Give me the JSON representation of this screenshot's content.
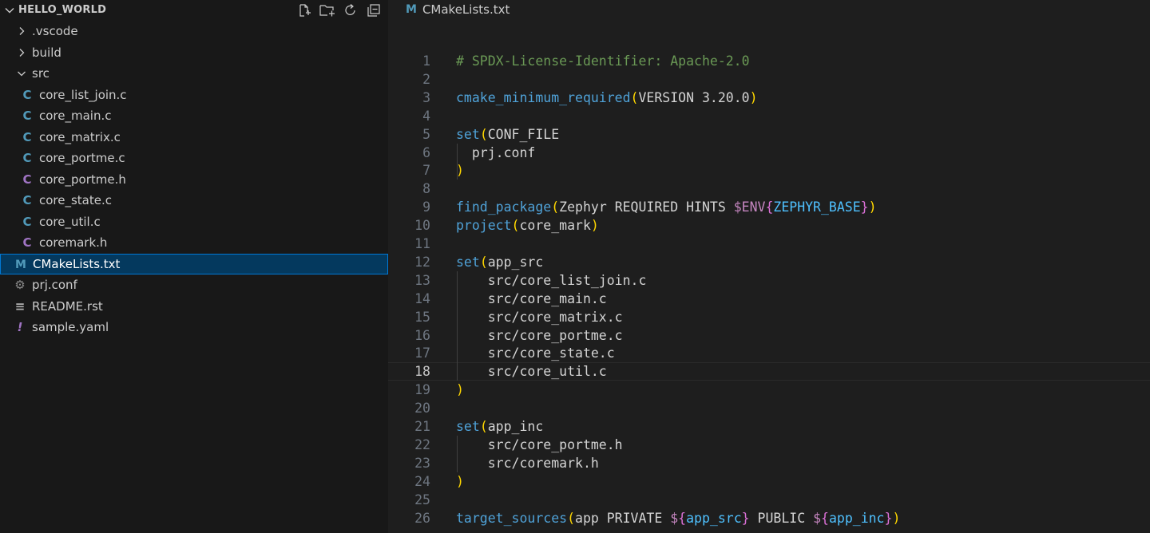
{
  "explorer": {
    "title": "HELLO_WORLD",
    "actions": [
      {
        "icon": "new-file-icon"
      },
      {
        "icon": "new-folder-icon"
      },
      {
        "icon": "refresh-icon"
      },
      {
        "icon": "collapse-all-icon"
      }
    ],
    "items": [
      {
        "label": ".vscode",
        "kind": "folder",
        "expanded": false,
        "depth": 1
      },
      {
        "label": "build",
        "kind": "folder",
        "expanded": false,
        "depth": 1
      },
      {
        "label": "src",
        "kind": "folder",
        "expanded": true,
        "depth": 1
      },
      {
        "label": "core_list_join.c",
        "kind": "c",
        "icon_glyph": "C",
        "depth": 2
      },
      {
        "label": "core_main.c",
        "kind": "c",
        "icon_glyph": "C",
        "depth": 2
      },
      {
        "label": "core_matrix.c",
        "kind": "c",
        "icon_glyph": "C",
        "depth": 2
      },
      {
        "label": "core_portme.c",
        "kind": "c",
        "icon_glyph": "C",
        "depth": 2
      },
      {
        "label": "core_portme.h",
        "kind": "h",
        "icon_glyph": "C",
        "depth": 2
      },
      {
        "label": "core_state.c",
        "kind": "c",
        "icon_glyph": "C",
        "depth": 2
      },
      {
        "label": "core_util.c",
        "kind": "c",
        "icon_glyph": "C",
        "depth": 2
      },
      {
        "label": "coremark.h",
        "kind": "h",
        "icon_glyph": "C",
        "depth": 2
      },
      {
        "label": "CMakeLists.txt",
        "kind": "cmake",
        "icon_glyph": "M",
        "depth": 1,
        "selected": true
      },
      {
        "label": "prj.conf",
        "kind": "gear",
        "icon_glyph": "⚙",
        "depth": 1
      },
      {
        "label": "README.rst",
        "kind": "lines",
        "icon_glyph": "≡",
        "depth": 1
      },
      {
        "label": "sample.yaml",
        "kind": "yaml",
        "icon_glyph": "!",
        "depth": 1
      }
    ]
  },
  "editor": {
    "tab": {
      "icon_glyph": "M",
      "label": "CMakeLists.txt"
    },
    "current_line": 18,
    "lines": [
      {
        "n": "1",
        "tokens": [
          {
            "t": "# SPDX-License-Identifier: Apache-2.0",
            "c": "comment"
          }
        ]
      },
      {
        "n": "2",
        "tokens": []
      },
      {
        "n": "3",
        "tokens": [
          {
            "t": "cmake_minimum_required",
            "c": "fn"
          },
          {
            "t": "(",
            "c": "paren"
          },
          {
            "t": "VERSION 3.20.0",
            "c": "text"
          },
          {
            "t": ")",
            "c": "paren"
          }
        ]
      },
      {
        "n": "4",
        "tokens": []
      },
      {
        "n": "5",
        "tokens": [
          {
            "t": "set",
            "c": "fn"
          },
          {
            "t": "(",
            "c": "paren"
          },
          {
            "t": "CONF_FILE",
            "c": "text"
          }
        ]
      },
      {
        "n": "6",
        "tokens": [
          {
            "t": "  prj.conf",
            "c": "text"
          }
        ]
      },
      {
        "n": "7",
        "tokens": [
          {
            "t": ")",
            "c": "paren"
          }
        ]
      },
      {
        "n": "8",
        "tokens": []
      },
      {
        "n": "9",
        "tokens": [
          {
            "t": "find_package",
            "c": "fn"
          },
          {
            "t": "(",
            "c": "paren"
          },
          {
            "t": "Zephyr REQUIRED HINTS ",
            "c": "text"
          },
          {
            "t": "$ENV",
            "c": "env"
          },
          {
            "t": "{",
            "c": "brace"
          },
          {
            "t": "ZEPHYR_BASE",
            "c": "var"
          },
          {
            "t": "}",
            "c": "brace"
          },
          {
            "t": ")",
            "c": "paren"
          }
        ]
      },
      {
        "n": "10",
        "tokens": [
          {
            "t": "project",
            "c": "fn"
          },
          {
            "t": "(",
            "c": "paren"
          },
          {
            "t": "core_mark",
            "c": "text"
          },
          {
            "t": ")",
            "c": "paren"
          }
        ]
      },
      {
        "n": "11",
        "tokens": []
      },
      {
        "n": "12",
        "tokens": [
          {
            "t": "set",
            "c": "fn"
          },
          {
            "t": "(",
            "c": "paren"
          },
          {
            "t": "app_src",
            "c": "text"
          }
        ]
      },
      {
        "n": "13",
        "tokens": [
          {
            "t": "    src/core_list_join.c",
            "c": "text"
          }
        ]
      },
      {
        "n": "14",
        "tokens": [
          {
            "t": "    src/core_main.c",
            "c": "text"
          }
        ]
      },
      {
        "n": "15",
        "tokens": [
          {
            "t": "    src/core_matrix.c",
            "c": "text"
          }
        ]
      },
      {
        "n": "16",
        "tokens": [
          {
            "t": "    src/core_portme.c",
            "c": "text"
          }
        ]
      },
      {
        "n": "17",
        "tokens": [
          {
            "t": "    src/core_state.c",
            "c": "text"
          }
        ]
      },
      {
        "n": "18",
        "tokens": [
          {
            "t": "    src/core_util.c",
            "c": "text"
          }
        ]
      },
      {
        "n": "19",
        "tokens": [
          {
            "t": ")",
            "c": "paren"
          }
        ]
      },
      {
        "n": "20",
        "tokens": []
      },
      {
        "n": "21",
        "tokens": [
          {
            "t": "set",
            "c": "fn"
          },
          {
            "t": "(",
            "c": "paren"
          },
          {
            "t": "app_inc",
            "c": "text"
          }
        ]
      },
      {
        "n": "22",
        "tokens": [
          {
            "t": "    src/core_portme.h",
            "c": "text"
          }
        ]
      },
      {
        "n": "23",
        "tokens": [
          {
            "t": "    src/coremark.h",
            "c": "text"
          }
        ]
      },
      {
        "n": "24",
        "tokens": [
          {
            "t": ")",
            "c": "paren"
          }
        ]
      },
      {
        "n": "25",
        "tokens": []
      },
      {
        "n": "26",
        "tokens": [
          {
            "t": "target_sources",
            "c": "fn"
          },
          {
            "t": "(",
            "c": "paren"
          },
          {
            "t": "app PRIVATE ",
            "c": "text"
          },
          {
            "t": "$",
            "c": "env"
          },
          {
            "t": "{",
            "c": "brace"
          },
          {
            "t": "app_src",
            "c": "var"
          },
          {
            "t": "}",
            "c": "brace"
          },
          {
            "t": " PUBLIC ",
            "c": "text"
          },
          {
            "t": "$",
            "c": "env"
          },
          {
            "t": "{",
            "c": "brace"
          },
          {
            "t": "app_inc",
            "c": "var"
          },
          {
            "t": "}",
            "c": "brace"
          },
          {
            "t": ")",
            "c": "paren"
          }
        ]
      }
    ]
  }
}
